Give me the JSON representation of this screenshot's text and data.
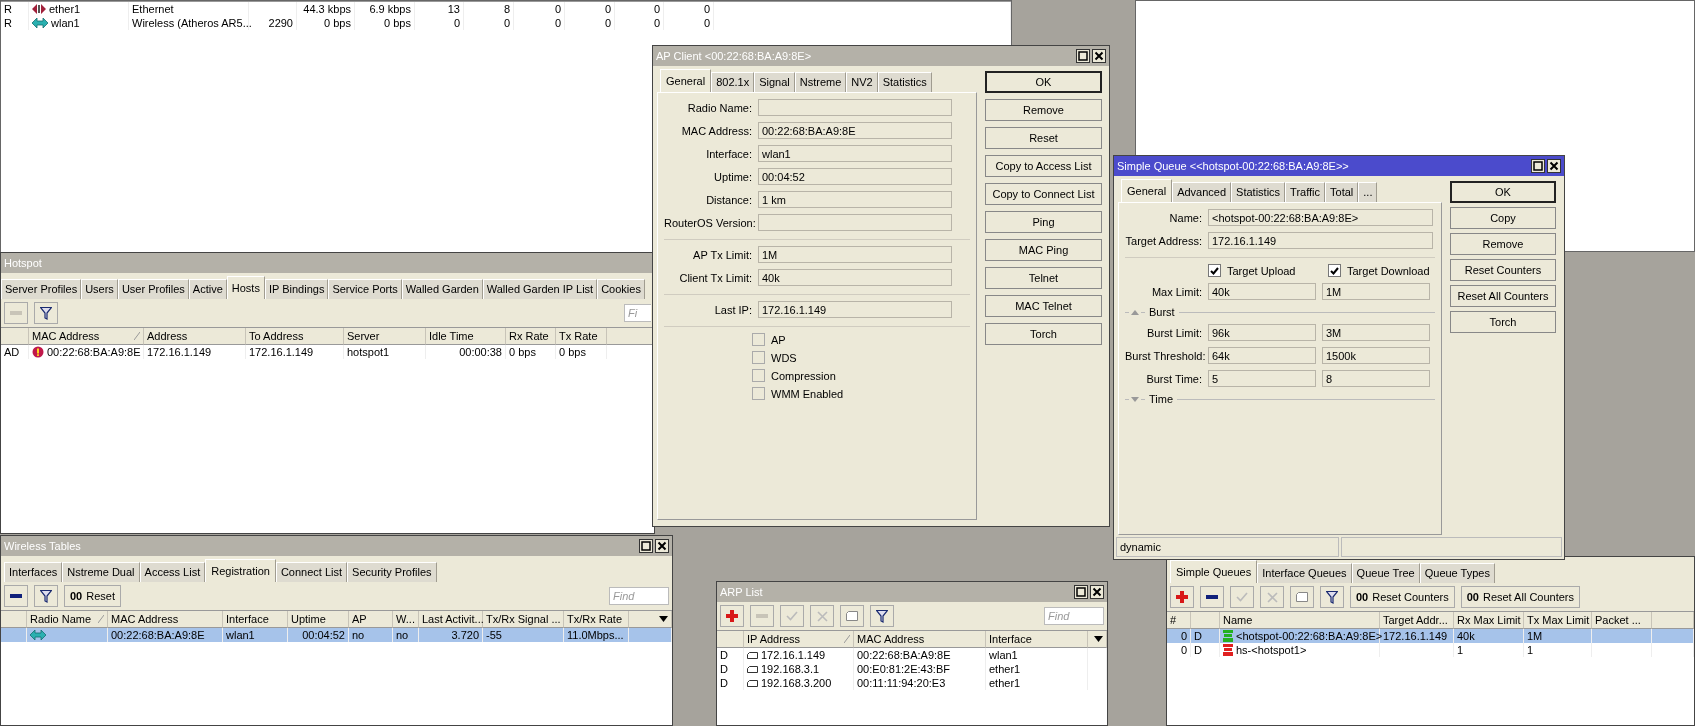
{
  "interfaces_window": {
    "rows": [
      {
        "kind": "ethernet",
        "column_1": "R",
        "column_2": "ether1",
        "column_3": "Ethernet",
        "column_5": "44.3 kbps",
        "column_6": "6.9 kbps",
        "column_7": "13",
        "column_8": "8",
        "column_9": "0",
        "column_10": "0",
        "column_11": "0",
        "column_12": "0"
      },
      {
        "kind": "wireless",
        "column_1": "R",
        "column_2": "wlan1",
        "column_3": "Wireless (Atheros AR5...",
        "column_4": "2290",
        "column_5": "0 bps",
        "column_6": "0 bps",
        "column_7": "0",
        "column_8": "0",
        "column_9": "0",
        "column_10": "0",
        "column_11": "0",
        "column_12": "0"
      }
    ]
  },
  "hotspot_window": {
    "title": "Hotspot",
    "active": false,
    "tabs": [
      {
        "label": "Server Profiles",
        "selected": false
      },
      {
        "label": "Users",
        "selected": false
      },
      {
        "label": "User Profiles",
        "selected": false
      },
      {
        "label": "Active",
        "selected": false
      },
      {
        "label": "Hosts",
        "selected": true
      },
      {
        "label": "IP Bindings",
        "selected": false
      },
      {
        "label": "Service Ports",
        "selected": false
      },
      {
        "label": "Walled Garden",
        "selected": false
      },
      {
        "label": "Walled Garden IP List",
        "selected": false
      },
      {
        "label": "Cookies",
        "selected": false
      }
    ],
    "find": {
      "placeholder": "Fi"
    },
    "columns": [
      "MAC Address",
      "Address",
      "To Address",
      "Server",
      "Idle Time",
      "Rx Rate",
      "Tx Rate"
    ],
    "rows": [
      {
        "selected": false,
        "flags": "AD",
        "mac_address": "00:22:68:BA:A9:8E",
        "address": "172.16.1.149",
        "to_address": "172.16.1.149",
        "server": "hotspot1",
        "idle_time": "00:00:38",
        "rx_rate": "0 bps",
        "tx_rate": "0 bps"
      }
    ]
  },
  "wireless_tables_window": {
    "title": "Wireless Tables",
    "active": false,
    "tabs": [
      {
        "label": "Interfaces",
        "selected": false
      },
      {
        "label": "Nstreme Dual",
        "selected": false
      },
      {
        "label": "Access List",
        "selected": false
      },
      {
        "label": "Registration",
        "selected": true
      },
      {
        "label": "Connect List",
        "selected": false
      },
      {
        "label": "Security Profiles",
        "selected": false
      }
    ],
    "reset_button": {
      "glyph": "00",
      "label": "Reset"
    },
    "find": {
      "placeholder": "Find"
    },
    "columns": [
      "Radio Name",
      "MAC Address",
      "Interface",
      "Uptime",
      "AP",
      "W...",
      "Last Activit...",
      "Tx/Rx Signal ...",
      "Tx/Rx Rate"
    ],
    "rows": [
      {
        "selected": true,
        "mac_address": "00:22:68:BA:A9:8E",
        "interface": "wlan1",
        "uptime": "00:04:52",
        "ap": "no",
        "wds": "no",
        "last_activity": "3.720",
        "signal": "-55",
        "rate": "11.0Mbps..."
      }
    ]
  },
  "arp_list_window": {
    "title": "ARP List",
    "active": false,
    "find": {
      "placeholder": "Find"
    },
    "columns": [
      "IP Address",
      "MAC Address",
      "Interface"
    ],
    "rows": [
      {
        "selected": false,
        "flags": "D",
        "ip_address": "172.16.1.149",
        "mac_address": "00:22:68:BA:A9:8E",
        "interface": "wlan1"
      },
      {
        "selected": false,
        "flags": "D",
        "ip_address": "192.168.3.1",
        "mac_address": "00:E0:81:2E:43:BF",
        "interface": "ether1"
      },
      {
        "selected": false,
        "flags": "D",
        "ip_address": "192.168.3.200",
        "mac_address": "00:11:11:94:20:E3",
        "interface": "ether1"
      }
    ]
  },
  "queue_window": {
    "tabs": [
      {
        "label": "Simple Queues",
        "selected": true
      },
      {
        "label": "Interface Queues",
        "selected": false
      },
      {
        "label": "Queue Tree",
        "selected": false
      },
      {
        "label": "Queue Types",
        "selected": false
      }
    ],
    "toolbar_buttons": [
      {
        "glyph": "00",
        "label": "Reset Counters"
      },
      {
        "glyph": "00",
        "label": "Reset All Counters"
      }
    ],
    "columns": [
      "#",
      "Name",
      "Target Addr...",
      "Rx Max Limit",
      "Tx Max Limit",
      "Packet ..."
    ],
    "rows": [
      {
        "selected": true,
        "color": "#22b022",
        "number": "0",
        "flags": "D",
        "name": "<hotspot-00:22:68:BA:A9:8E>",
        "target": "172.16.1.149",
        "rx_max_limit": "40k",
        "tx_max_limit": "1M"
      },
      {
        "selected": false,
        "color": "#e02020",
        "number": "0",
        "flags": "D",
        "name": "hs-<hotspot1>",
        "rx_max_limit": "1",
        "tx_max_limit": "1"
      }
    ]
  },
  "ap_client_window": {
    "title": "AP Client <00:22:68:BA:A9:8E>",
    "active": false,
    "tabs": [
      {
        "label": "General",
        "selected": true
      },
      {
        "label": "802.1x",
        "selected": false
      },
      {
        "label": "Signal",
        "selected": false
      },
      {
        "label": "Nstreme",
        "selected": false
      },
      {
        "label": "NV2",
        "selected": false
      },
      {
        "label": "Statistics",
        "selected": false
      }
    ],
    "field_groups": [
      [
        {
          "label": "Radio Name:"
        },
        {
          "label": "MAC Address:",
          "value": "00:22:68:BA:A9:8E"
        },
        {
          "label": "Interface:",
          "value": "wlan1"
        },
        {
          "label": "Uptime:",
          "value": "00:04:52"
        },
        {
          "label": "Distance:",
          "value": "1 km"
        },
        {
          "label": "RouterOS Version:"
        }
      ],
      [
        {
          "label": "AP Tx Limit:",
          "value": "1M"
        },
        {
          "label": "Client Tx Limit:",
          "value": "40k"
        }
      ],
      [
        {
          "label": "Last IP:",
          "value": "172.16.1.149"
        }
      ]
    ],
    "checkboxes": [
      {
        "label": "AP",
        "checked": false
      },
      {
        "label": "WDS",
        "checked": false
      },
      {
        "label": "Compression",
        "checked": false
      },
      {
        "label": "WMM Enabled",
        "checked": false
      }
    ],
    "buttons": [
      {
        "label": "OK",
        "default": true
      },
      {
        "label": "Remove",
        "default": false
      },
      {
        "label": "Reset",
        "default": false
      },
      {
        "label": "Copy to Access List",
        "default": false
      },
      {
        "label": "Copy to Connect List",
        "default": false
      },
      {
        "label": "Ping",
        "default": false
      },
      {
        "label": "MAC Ping",
        "default": false
      },
      {
        "label": "Telnet",
        "default": false
      },
      {
        "label": "MAC Telnet",
        "default": false
      },
      {
        "label": "Torch",
        "default": false
      }
    ]
  },
  "simple_queue_window": {
    "title": "Simple Queue <<hotspot-00:22:68:BA:A9:8E>>",
    "active": true,
    "tabs": [
      {
        "label": "General",
        "selected": true
      },
      {
        "label": "Advanced",
        "selected": false
      },
      {
        "label": "Statistics",
        "selected": false
      },
      {
        "label": "Traffic",
        "selected": false
      },
      {
        "label": "Total",
        "selected": false
      },
      {
        "label": "...",
        "selected": false
      }
    ],
    "fields": [
      {
        "label": "Name:",
        "value": "<hotspot-00:22:68:BA:A9:8E>"
      },
      {
        "label": "Target Address:",
        "value": "172.16.1.149"
      }
    ],
    "direction_checks": [
      {
        "label": "Target Upload",
        "checked": true
      },
      {
        "label": "Target Download",
        "checked": true
      }
    ],
    "max_limit": {
      "label": "Max Limit:",
      "upload": "40k",
      "download": "1M"
    },
    "sections": [
      {
        "title": "Burst",
        "expanded": true,
        "rows": [
          {
            "label": "Burst Limit:",
            "upload": "96k",
            "download": "3M"
          },
          {
            "label": "Burst Threshold:",
            "upload": "64k",
            "download": "1500k"
          },
          {
            "label": "Burst Time:",
            "upload": "5",
            "download": "8"
          }
        ]
      },
      {
        "title": "Time",
        "expanded": false
      }
    ],
    "status": "dynamic",
    "buttons": [
      {
        "label": "OK",
        "default": true
      },
      {
        "label": "Copy",
        "default": false
      },
      {
        "label": "Remove",
        "default": false
      },
      {
        "label": "Reset Counters",
        "default": false
      },
      {
        "label": "Reset All Counters",
        "default": false
      },
      {
        "label": "Torch",
        "default": false
      }
    ]
  }
}
